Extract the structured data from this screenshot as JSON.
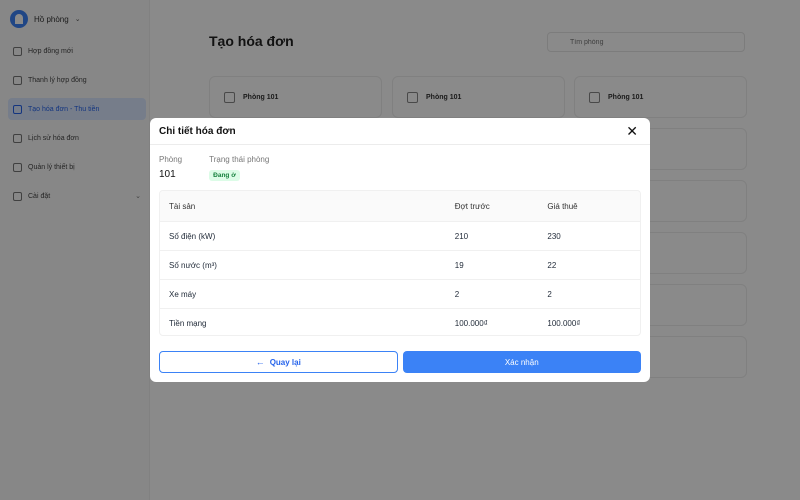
{
  "sidebar": {
    "brand": "Hồ phòng",
    "items": [
      {
        "label": "Hợp đồng mới",
        "icon": "file-plus-icon"
      },
      {
        "label": "Thanh lý hợp đồng",
        "icon": "file-edit-icon"
      },
      {
        "label": "Tạo hóa đơn - Thu tiền",
        "icon": "receipt-icon",
        "active": true
      },
      {
        "label": "Lịch sử hóa đơn",
        "icon": "history-icon"
      },
      {
        "label": "Quản lý thiết bị",
        "icon": "device-icon"
      },
      {
        "label": "Cài đặt",
        "icon": "gear-icon",
        "expandable": true
      }
    ]
  },
  "main": {
    "title": "Tạo hóa đơn",
    "search_placeholder": "Tìm phòng",
    "rooms": [
      {
        "label": "Phòng 101"
      },
      {
        "label": "Phòng 101"
      },
      {
        "label": "Phòng 101"
      }
    ]
  },
  "modal": {
    "title": "Chi tiết hóa đơn",
    "room_label": "Phòng",
    "room_value": "101",
    "status_label": "Trạng thái phòng",
    "status_value": "Đang ở",
    "table": {
      "headers": [
        "Tài sản",
        "Đợt trước",
        "Giá thuê"
      ],
      "rows": [
        [
          "Số điện (kW)",
          "210",
          "230"
        ],
        [
          "Số nước (m³)",
          "19",
          "22"
        ],
        [
          "Xe máy",
          "2",
          "2"
        ],
        [
          "Tiền mạng",
          "100.000₫",
          "100.000₫"
        ]
      ]
    },
    "back_label": "Quay lại",
    "confirm_label": "Xác nhận"
  },
  "colors": {
    "primary": "#3b82f6",
    "status_bg": "#dcfce7",
    "status_text": "#15803d"
  }
}
